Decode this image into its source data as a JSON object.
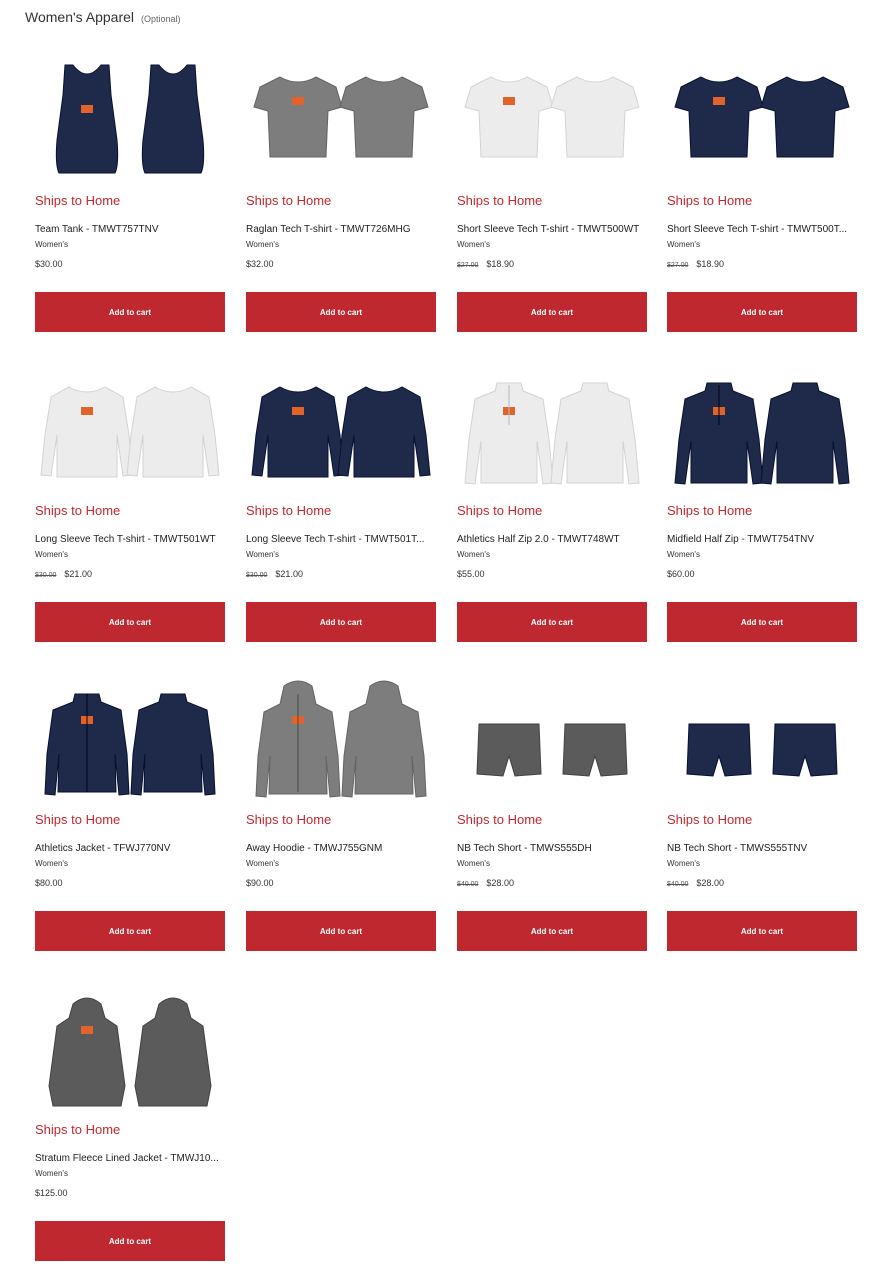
{
  "section": {
    "title": "Women's Apparel",
    "optional_label": "(Optional)"
  },
  "colors": {
    "accent": "#c0282f",
    "navy": "#1f2a4a",
    "gray": "#7a7a7a",
    "white_garment": "#eeeeee",
    "dark_gray": "#5a5a5a"
  },
  "products": [
    {
      "ships": "Ships to Home",
      "name": "Team Tank - TMWT757TNV",
      "gender": "Women's",
      "old_price": "",
      "price": "$30.00",
      "button": "Add to cart",
      "garment": "tank",
      "color": "navy"
    },
    {
      "ships": "Ships to Home",
      "name": "Raglan Tech T-shirt - TMWT726MHG",
      "gender": "Women's",
      "old_price": "",
      "price": "$32.00",
      "button": "Add to cart",
      "garment": "tee",
      "color": "gray"
    },
    {
      "ships": "Ships to Home",
      "name": "Short Sleeve Tech T-shirt - TMWT500WT",
      "gender": "Women's",
      "old_price": "$27.00",
      "price": "$18.90",
      "button": "Add to cart",
      "garment": "tee",
      "color": "white"
    },
    {
      "ships": "Ships to Home",
      "name": "Short Sleeve Tech T-shirt - TMWT500T...",
      "gender": "Women's",
      "old_price": "$27.00",
      "price": "$18.90",
      "button": "Add to cart",
      "garment": "tee",
      "color": "navy"
    },
    {
      "ships": "Ships to Home",
      "name": "Long Sleeve Tech T-shirt - TMWT501WT",
      "gender": "Women's",
      "old_price": "$30.00",
      "price": "$21.00",
      "button": "Add to cart",
      "garment": "longsleeve",
      "color": "white"
    },
    {
      "ships": "Ships to Home",
      "name": "Long Sleeve Tech T-shirt - TMWT501T...",
      "gender": "Women's",
      "old_price": "$30.00",
      "price": "$21.00",
      "button": "Add to cart",
      "garment": "longsleeve",
      "color": "navy"
    },
    {
      "ships": "Ships to Home",
      "name": "Athletics Half Zip 2.0 - TMWT748WT",
      "gender": "Women's",
      "old_price": "",
      "price": "$55.00",
      "button": "Add to cart",
      "garment": "halfzip",
      "color": "white"
    },
    {
      "ships": "Ships to Home",
      "name": "Midfield Half Zip - TMWT754TNV",
      "gender": "Women's",
      "old_price": "",
      "price": "$60.00",
      "button": "Add to cart",
      "garment": "halfzip",
      "color": "navy"
    },
    {
      "ships": "Ships to Home",
      "name": "Athletics Jacket - TFWJ770NV",
      "gender": "Women's",
      "old_price": "",
      "price": "$80.00",
      "button": "Add to cart",
      "garment": "jacket",
      "color": "navy"
    },
    {
      "ships": "Ships to Home",
      "name": "Away Hoodie - TMWJ755GNM",
      "gender": "Women's",
      "old_price": "",
      "price": "$90.00",
      "button": "Add to cart",
      "garment": "hoodie",
      "color": "gray"
    },
    {
      "ships": "Ships to Home",
      "name": "NB Tech Short - TMWS555DH",
      "gender": "Women's",
      "old_price": "$40.00",
      "price": "$28.00",
      "button": "Add to cart",
      "garment": "shorts",
      "color": "darkgray"
    },
    {
      "ships": "Ships to Home",
      "name": "NB Tech Short - TMWS555TNV",
      "gender": "Women's",
      "old_price": "$40.00",
      "price": "$28.00",
      "button": "Add to cart",
      "garment": "shorts",
      "color": "navy"
    },
    {
      "ships": "Ships to Home",
      "name": "Stratum Fleece Lined Jacket - TMWJ10...",
      "gender": "Women's",
      "old_price": "",
      "price": "$125.00",
      "button": "Add to cart",
      "garment": "parka",
      "color": "darkgray"
    }
  ]
}
